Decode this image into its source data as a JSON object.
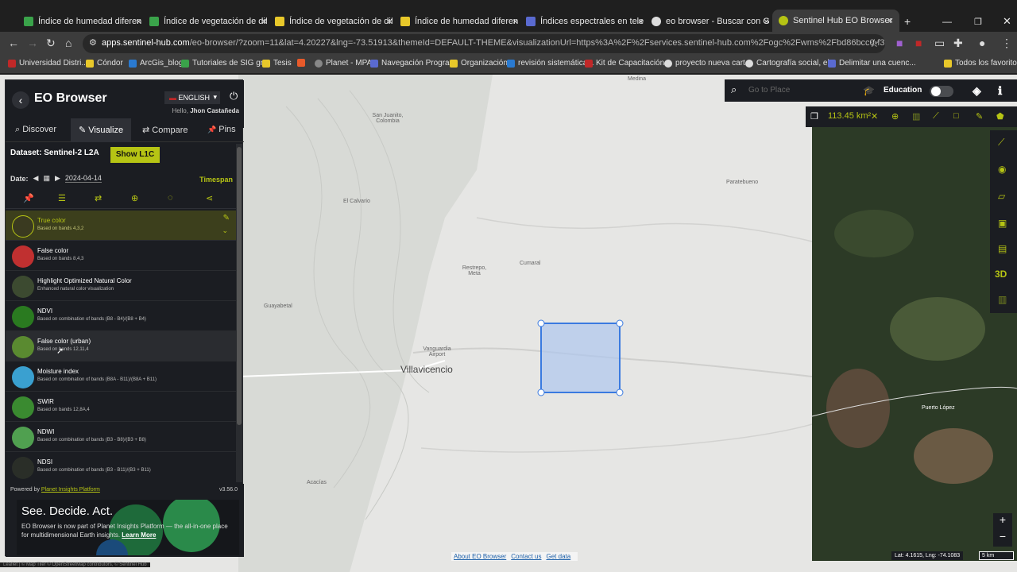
{
  "browser": {
    "tabs": [
      {
        "title": "Índice de humedad diferencial",
        "color": "#3aa34a"
      },
      {
        "title": "Índice de vegetación de diferen",
        "color": "#3aa34a"
      },
      {
        "title": "Índice de vegetación de diferen",
        "color": "#e8c82a"
      },
      {
        "title": "Índice de humedad diferencial",
        "color": "#e8c82a"
      },
      {
        "title": "Índices espectrales en teledete",
        "color": "#5a6ad0"
      },
      {
        "title": "eo browser - Buscar con Googl",
        "color": "#dddddd"
      },
      {
        "title": "Sentinel Hub EO Browser",
        "color": "#b6c414"
      }
    ],
    "tab_close": "×",
    "new_tab": "+",
    "url_host": "apps.sentinel-hub.com",
    "url_rest": "/eo-browser/?zoom=11&lat=4.20227&lng=-73.51913&themeId=DEFAULT-THEME&visualizationUrl=https%3A%2F%2Fservices.sentinel-hub.com%2Fogc%2Fwms%2Fbd86bcc0-f318-402b-a145-015f85b9427e&...",
    "bookmarks": [
      {
        "label": "Universidad Distri...",
        "color": "#c02828"
      },
      {
        "label": "Cóndor",
        "color": "#e8c82a"
      },
      {
        "label": "ArcGis_blog",
        "color": "#2a7ad0"
      },
      {
        "label": "Tutoriales de SIG gr...",
        "color": "#3aa34a"
      },
      {
        "label": "Tesis",
        "color": "#e8c82a"
      },
      {
        "label": "",
        "color": "#e85a2a"
      },
      {
        "label": "Planet - MPA",
        "color": "#888888"
      },
      {
        "label": "Navegación Progra...",
        "color": "#5a6ad0"
      },
      {
        "label": "Organización",
        "color": "#e8c82a"
      },
      {
        "label": "revisión sistemática...",
        "color": "#2a7ad0"
      },
      {
        "label": "Kit de Capacitación...",
        "color": "#c02828"
      },
      {
        "label": "proyecto nueva cart...",
        "color": "#dddddd"
      },
      {
        "label": "Cartografía social, el...",
        "color": "#dddddd"
      },
      {
        "label": "Delimitar una cuenc...",
        "color": "#5a6ad0"
      },
      {
        "label": "Todos los favoritos",
        "color": "#e8c82a"
      }
    ]
  },
  "panel": {
    "back": "‹",
    "title": "EO Browser",
    "language": "ENGLISH",
    "hello_prefix": "Hello,",
    "hello_name": "Jhon Castañeda",
    "tabs": [
      {
        "label": "Discover",
        "icon": "⌕"
      },
      {
        "label": "Visualize",
        "icon": "✎"
      },
      {
        "label": "Compare",
        "icon": "⇄"
      },
      {
        "label": "Pins",
        "icon": "📌"
      }
    ],
    "dataset_label": "Dataset:",
    "dataset_value": "Sentinel-2 L2A",
    "show_l1c": "Show L1C",
    "date_label": "Date:",
    "date_value": "2024-04-14",
    "timespan": "Timespan",
    "layers": [
      {
        "name": "True color",
        "desc": "Based on bands 4,3,2",
        "thumb": "#3a3a20"
      },
      {
        "name": "False color",
        "desc": "Based on bands 8,4,3",
        "thumb": "#c03030"
      },
      {
        "name": "Highlight Optimized Natural Color",
        "desc": "Enhanced natural color visualization",
        "thumb": "#3c4a30"
      },
      {
        "name": "NDVI",
        "desc": "Based on combination of bands (B8 - B4)/(B8 + B4)",
        "thumb": "#2a7a20"
      },
      {
        "name": "False color (urban)",
        "desc": "Based on bands 12,11,4",
        "thumb": "#5a8a30"
      },
      {
        "name": "Moisture index",
        "desc": "Based on combination of bands (B8A - B11)/(B8A + B11)",
        "thumb": "#3aa0d0"
      },
      {
        "name": "SWIR",
        "desc": "Based on bands 12,8A,4",
        "thumb": "#3a8a30"
      },
      {
        "name": "NDWI",
        "desc": "Based on combination of bands (B3 - B8)/(B3 + B8)",
        "thumb": "#50a050"
      },
      {
        "name": "NDSI",
        "desc": "Based on combination of bands (B3 - B11)/(B3 + B11)",
        "thumb": "#2a2e28"
      }
    ],
    "powered_prefix": "Powered by",
    "powered_link": "Planet Insights Platform",
    "version": "v3.56.0",
    "ad_title": "See. Decide. Act.",
    "ad_body": "EO Browser is now part of Planet Insights Platform — the all-in-one place for multidimensional Earth insights.",
    "ad_link": "Learn More"
  },
  "map": {
    "search_placeholder": "Go to Place",
    "education_label": "Education",
    "area": "113.45 km²",
    "coords": "Lat: 4.1615, Lng: -74.1083",
    "scale": "5 km",
    "zoom_in": "+",
    "zoom_out": "−",
    "links": [
      "About EO Browser",
      "Contact us",
      "Get data"
    ],
    "attribution": "Leaflet | © Map Tiler © OpenStreetMap contributors, © Sentinel Hub",
    "labels": [
      {
        "text": "Medina",
        "color": "#666666"
      },
      {
        "text": "San Juanito, Colombia",
        "color": "#666666"
      },
      {
        "text": "El Calvario",
        "color": "#666666"
      },
      {
        "text": "Restrepo, Meta",
        "color": "#666666"
      },
      {
        "text": "Cumaral",
        "color": "#666666"
      },
      {
        "text": "Guayabetal",
        "color": "#666666"
      },
      {
        "text": "Vanguardia Airport",
        "color": "#666666"
      },
      {
        "text": "Villavicencio",
        "color": "#444444"
      },
      {
        "text": "Acacías",
        "color": "#666666"
      },
      {
        "text": "Paratebueno",
        "color": "#666666"
      },
      {
        "text": "Puerto López",
        "color": "#ffffff"
      }
    ]
  }
}
